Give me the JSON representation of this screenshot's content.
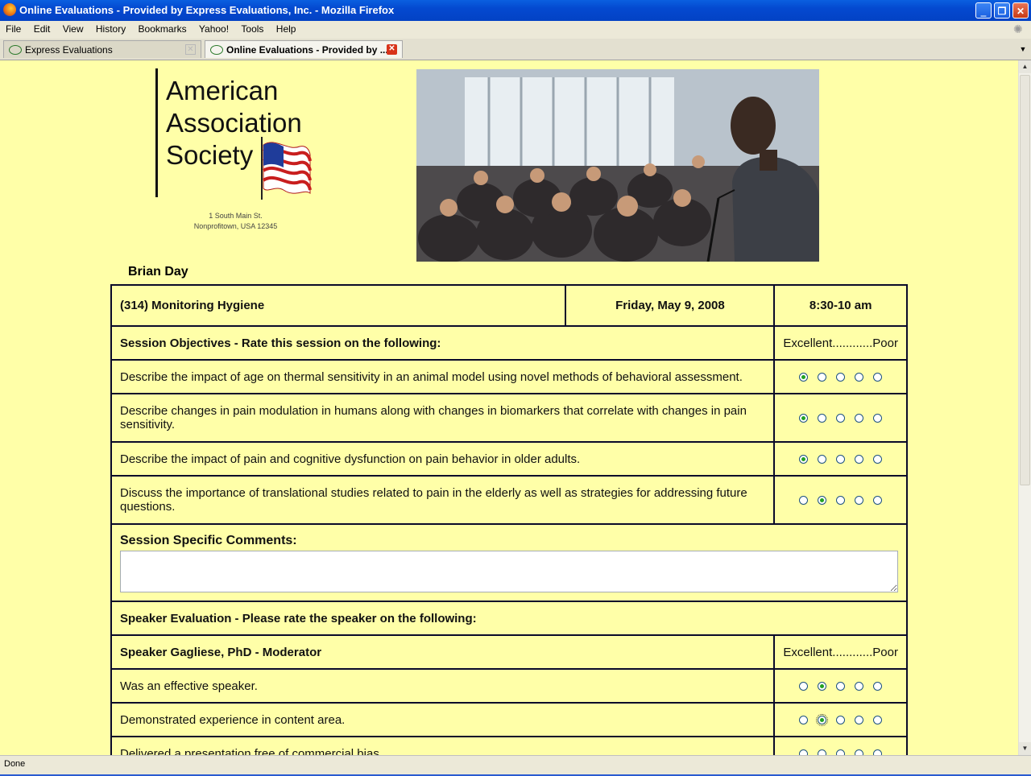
{
  "window": {
    "title": "Online Evaluations - Provided by Express Evaluations, Inc. - Mozilla Firefox",
    "minimize": "‗",
    "restore": "❐",
    "close": "✕"
  },
  "menu": [
    "File",
    "Edit",
    "View",
    "History",
    "Bookmarks",
    "Yahoo!",
    "Tools",
    "Help"
  ],
  "tabs": [
    {
      "label": "Express Evaluations",
      "active": false
    },
    {
      "label": "Online Evaluations - Provided by ...",
      "active": true
    }
  ],
  "logo": {
    "line1": "American",
    "line2": "Association",
    "line3": "Society",
    "address1": "1 South Main St.",
    "address2": "Nonprofitown, USA 12345"
  },
  "attendee": "Brian Day",
  "session": {
    "title": "(314) Monitoring Hygiene",
    "date": "Friday, May 9, 2008",
    "time": "8:30-10 am"
  },
  "objectives": {
    "heading": "Session Objectives - Rate this session on the following:",
    "scale": "Excellent............Poor",
    "items": [
      {
        "text": "Describe the impact of age on thermal sensitivity in an animal model using novel methods of behavioral assessment.",
        "selected": 1
      },
      {
        "text": "Describe changes in pain modulation in humans along with changes in biomarkers that correlate with changes in pain sensitivity.",
        "selected": 1
      },
      {
        "text": "Describe the impact of pain and cognitive dysfunction on pain behavior in older adults.",
        "selected": 1
      },
      {
        "text": "Discuss the importance of translational studies related to pain in the elderly as well as strategies for addressing future questions.",
        "selected": 2
      }
    ]
  },
  "comments": {
    "label": "Session Specific Comments:",
    "value": ""
  },
  "speaker_eval": {
    "heading": "Speaker Evaluation - Please rate the speaker on the following:",
    "speaker": "Speaker Gagliese, PhD - Moderator",
    "scale": "Excellent............Poor",
    "items": [
      {
        "text": "Was an effective speaker.",
        "selected": 2
      },
      {
        "text": "Demonstrated experience in content area.",
        "selected": 2,
        "focused": true
      },
      {
        "text": "Delivered a presentation free of commercial bias.",
        "selected": 0
      }
    ]
  },
  "status": "Done"
}
